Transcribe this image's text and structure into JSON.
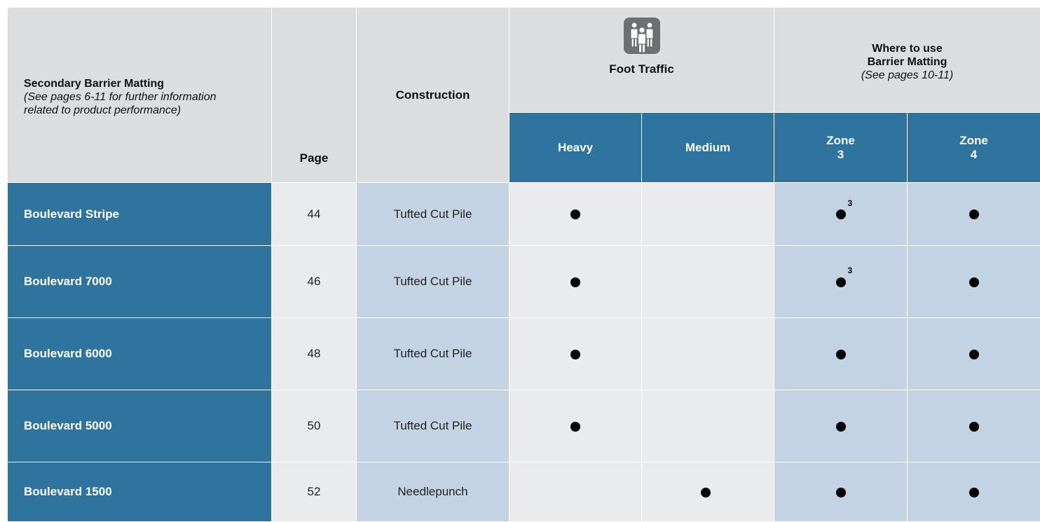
{
  "header": {
    "title": "Secondary Barrier Matting",
    "subtitle": "(See pages 6-11 for further information related to product performance)",
    "page_label": "Page",
    "construction_label": "Construction",
    "foot_traffic_label": "Foot Traffic",
    "foot_traffic_icon": "people-group-icon",
    "where_line1": "Where to use",
    "where_line2": "Barrier Matting",
    "where_line3": "(See pages 10-11)",
    "heavy_label": "Heavy",
    "medium_label": "Medium",
    "zone3_line1": "Zone",
    "zone3_line2": "3",
    "zone4_line1": "Zone",
    "zone4_line2": "4"
  },
  "rows": [
    {
      "name": "Boulevard Stripe",
      "page": "44",
      "construction": "Tufted Cut Pile",
      "heavy": true,
      "medium": false,
      "zone3": true,
      "zone3_note": "3",
      "zone4": true
    },
    {
      "name": "Boulevard 7000",
      "page": "46",
      "construction": "Tufted Cut Pile",
      "heavy": true,
      "medium": false,
      "zone3": true,
      "zone3_note": "3",
      "zone4": true
    },
    {
      "name": "Boulevard 6000",
      "page": "48",
      "construction": "Tufted Cut Pile",
      "heavy": true,
      "medium": false,
      "zone3": true,
      "zone3_note": "",
      "zone4": true
    },
    {
      "name": "Boulevard 5000",
      "page": "50",
      "construction": "Tufted Cut Pile",
      "heavy": true,
      "medium": false,
      "zone3": true,
      "zone3_note": "",
      "zone4": true
    },
    {
      "name": "Boulevard 1500",
      "page": "52",
      "construction": "Needlepunch",
      "heavy": false,
      "medium": true,
      "zone3": true,
      "zone3_note": "",
      "zone4": true
    }
  ],
  "colors": {
    "header_gray": "#dcdddf",
    "brand_blue": "#2f739f",
    "light_gray": "#eaebec",
    "light_blue": "#c3d3e3",
    "icon_gray": "#6e6f71"
  }
}
